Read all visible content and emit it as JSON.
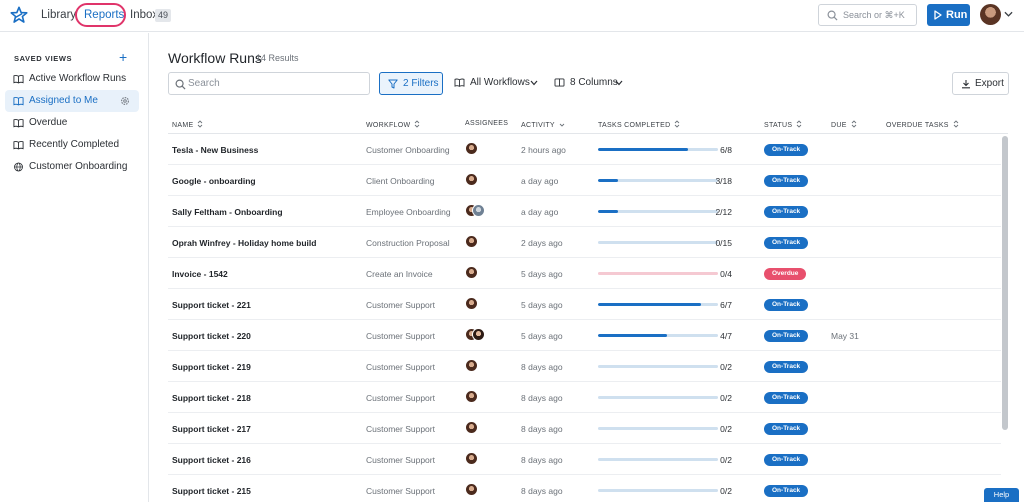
{
  "nav": {
    "library": "Library",
    "reports": "Reports",
    "inbox": "Inbox",
    "inbox_count": "49"
  },
  "global_search": {
    "placeholder": "Search or ⌘+K"
  },
  "run_label": "Run",
  "sidebar": {
    "title": "SAVED VIEWS",
    "items": [
      {
        "label": "Active Workflow Runs",
        "icon": "book-icon"
      },
      {
        "label": "Assigned to Me",
        "icon": "book-icon",
        "active": true
      },
      {
        "label": "Overdue",
        "icon": "book-icon"
      },
      {
        "label": "Recently Completed",
        "icon": "book-icon"
      },
      {
        "label": "Customer Onboarding",
        "icon": "globe-icon"
      }
    ]
  },
  "main": {
    "title": "Workflow Runs",
    "results": "14 Results",
    "search_placeholder": "Search",
    "filters_label": "2 Filters",
    "workflows_label": "All Workflows",
    "columns_label": "8 Columns",
    "export_label": "Export"
  },
  "table": {
    "headers": [
      "NAME",
      "WORKFLOW",
      "ASSIGNEES",
      "ACTIVITY",
      "TASKS COMPLETED",
      "STATUS",
      "DUE",
      "OVERDUE TASKS"
    ],
    "rows": [
      {
        "name": "Tesla - New Business",
        "workflow": "Customer Onboarding",
        "activity": "2 hours ago",
        "tasks": "6/8",
        "progress": 0.75,
        "status": "On-Track",
        "due": "",
        "assignees": 1
      },
      {
        "name": "Google - onboarding",
        "workflow": "Client Onboarding",
        "activity": "a day ago",
        "tasks": "3/18",
        "progress": 0.1667,
        "status": "On-Track",
        "due": "",
        "assignees": 1
      },
      {
        "name": "Sally Feltham - Onboarding",
        "workflow": "Employee Onboarding",
        "activity": "a day ago",
        "tasks": "2/12",
        "progress": 0.1667,
        "status": "On-Track",
        "due": "",
        "assignees": 2
      },
      {
        "name": "Oprah Winfrey - Holiday home build",
        "workflow": "Construction Proposal",
        "activity": "2 days ago",
        "tasks": "0/15",
        "progress": 0,
        "status": "On-Track",
        "due": "",
        "assignees": 1
      },
      {
        "name": "Invoice - 1542",
        "workflow": "Create an Invoice",
        "activity": "5 days ago",
        "tasks": "0/4",
        "progress": 0,
        "status": "Overdue",
        "due": "",
        "assignees": 1
      },
      {
        "name": "Support ticket - 221",
        "workflow": "Customer Support",
        "activity": "5 days ago",
        "tasks": "6/7",
        "progress": 0.857,
        "status": "On-Track",
        "due": "",
        "assignees": 1
      },
      {
        "name": "Support ticket - 220",
        "workflow": "Customer Support",
        "activity": "5 days ago",
        "tasks": "4/7",
        "progress": 0.571,
        "status": "On-Track",
        "due": "May 31",
        "assignees": 2
      },
      {
        "name": "Support ticket - 219",
        "workflow": "Customer Support",
        "activity": "8 days ago",
        "tasks": "0/2",
        "progress": 0,
        "status": "On-Track",
        "due": "",
        "assignees": 1
      },
      {
        "name": "Support ticket - 218",
        "workflow": "Customer Support",
        "activity": "8 days ago",
        "tasks": "0/2",
        "progress": 0,
        "status": "On-Track",
        "due": "",
        "assignees": 1
      },
      {
        "name": "Support ticket - 217",
        "workflow": "Customer Support",
        "activity": "8 days ago",
        "tasks": "0/2",
        "progress": 0,
        "status": "On-Track",
        "due": "",
        "assignees": 1
      },
      {
        "name": "Support ticket - 216",
        "workflow": "Customer Support",
        "activity": "8 days ago",
        "tasks": "0/2",
        "progress": 0,
        "status": "On-Track",
        "due": "",
        "assignees": 1
      },
      {
        "name": "Support ticket - 215",
        "workflow": "Customer Support",
        "activity": "8 days ago",
        "tasks": "0/2",
        "progress": 0,
        "status": "On-Track",
        "due": "",
        "assignees": 1
      }
    ]
  },
  "help_label": "Help",
  "colors": {
    "accent": "#1a6fc4",
    "overdue": "#e8506d",
    "highlight_ring": "#e0346a"
  }
}
